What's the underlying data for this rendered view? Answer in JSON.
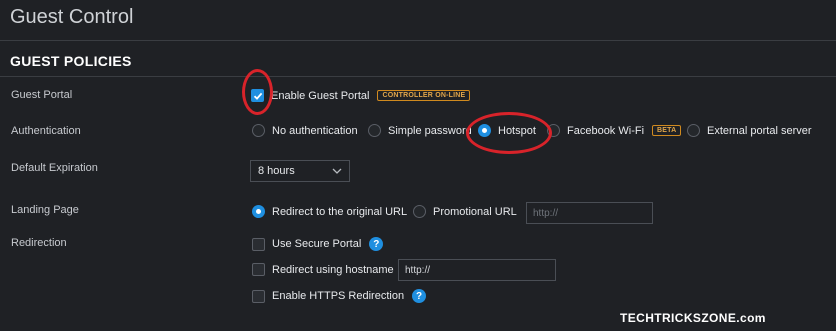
{
  "page": {
    "title": "Guest Control"
  },
  "section": {
    "title": "GUEST POLICIES"
  },
  "guest_portal": {
    "label": "Guest Portal",
    "checkbox_label": "Enable Guest Portal",
    "checked": true,
    "badge": "CONTROLLER ON-LINE"
  },
  "authentication": {
    "label": "Authentication",
    "options": [
      {
        "label": "No authentication",
        "checked": false
      },
      {
        "label": "Simple password",
        "checked": false
      },
      {
        "label": "Hotspot",
        "checked": true
      },
      {
        "label": "Facebook Wi-Fi",
        "checked": false,
        "badge": "BETA"
      },
      {
        "label": "External portal server",
        "checked": false
      }
    ]
  },
  "default_expiration": {
    "label": "Default Expiration",
    "value": "8 hours"
  },
  "landing_page": {
    "label": "Landing Page",
    "options": [
      {
        "label": "Redirect to the original URL",
        "checked": true
      },
      {
        "label": "Promotional URL",
        "checked": false
      }
    ],
    "url_placeholder": "http://"
  },
  "redirection": {
    "label": "Redirection",
    "secure_portal": "Use Secure Portal",
    "redirect_hostname": "Redirect using hostname",
    "hostname_value": "http://",
    "https_redirection": "Enable HTTPS Redirection",
    "help_glyph": "?"
  },
  "watermark": "TECHTRICKSZONE.com",
  "colors": {
    "accent": "#1f8fe0",
    "annotation": "#d8232a",
    "badge": "#d08a1f",
    "background": "#1f2125"
  }
}
